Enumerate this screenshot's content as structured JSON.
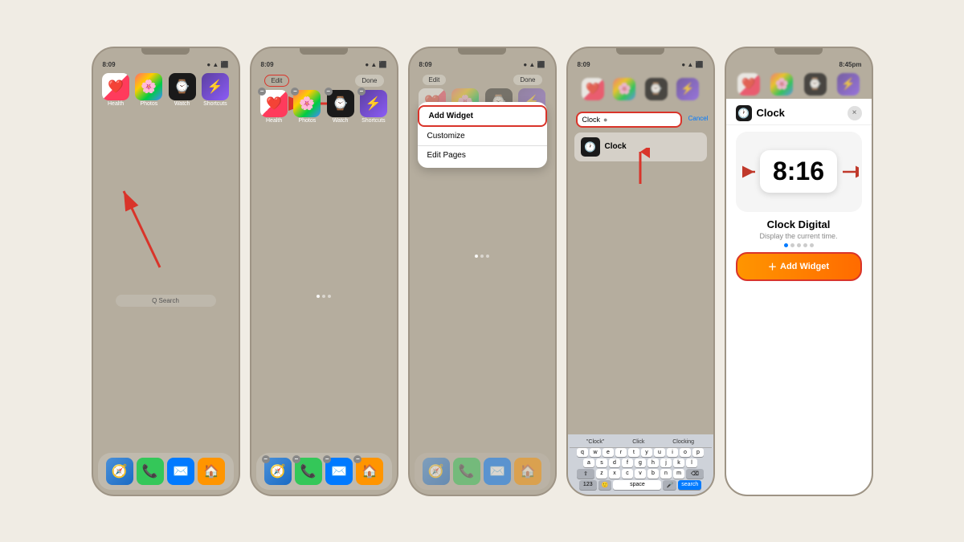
{
  "screens": [
    {
      "id": "screen1",
      "status": "8:09",
      "apps": [
        "Health",
        "Photos",
        "Watch",
        "Shortcuts"
      ],
      "dock": [
        "Safari",
        "Phone",
        "Mail",
        "Home"
      ],
      "search": "Q Search",
      "arrow": "long-press-hint"
    },
    {
      "id": "screen2",
      "edit_label": "Edit",
      "done_label": "Done",
      "apps": [
        "Health",
        "Photos",
        "Watch",
        "Shortcuts"
      ],
      "dock": [
        "Safari",
        "Phone",
        "Mail",
        "Home"
      ],
      "arrow": "points-to-edit"
    },
    {
      "id": "screen3",
      "edit_label": "Edit",
      "done_label": "Done",
      "menu_items": [
        "Add Widget",
        "Customize",
        "Edit Pages"
      ],
      "highlighted_item": "Add Widget"
    },
    {
      "id": "screen4",
      "search_text": "Clock",
      "cancel_label": "Cancel",
      "result_name": "Clock",
      "suggestions": [
        "\"Clock\"",
        "Click",
        "Clocking"
      ],
      "keyboard_rows": [
        [
          "q",
          "w",
          "e",
          "r",
          "t",
          "y",
          "u",
          "i",
          "o",
          "p"
        ],
        [
          "a",
          "s",
          "d",
          "f",
          "g",
          "h",
          "j",
          "k",
          "l"
        ],
        [
          "z",
          "x",
          "c",
          "v",
          "b",
          "n",
          "m"
        ],
        [
          "123",
          "space",
          "search"
        ]
      ]
    },
    {
      "id": "screen5",
      "status_time": "8:45pm",
      "app_icon_label": "Clock",
      "clock_time": "8:16",
      "widget_title": "Clock Digital",
      "widget_desc": "Display the current time.",
      "add_button_label": "Add Widget",
      "close_x": "×"
    }
  ]
}
